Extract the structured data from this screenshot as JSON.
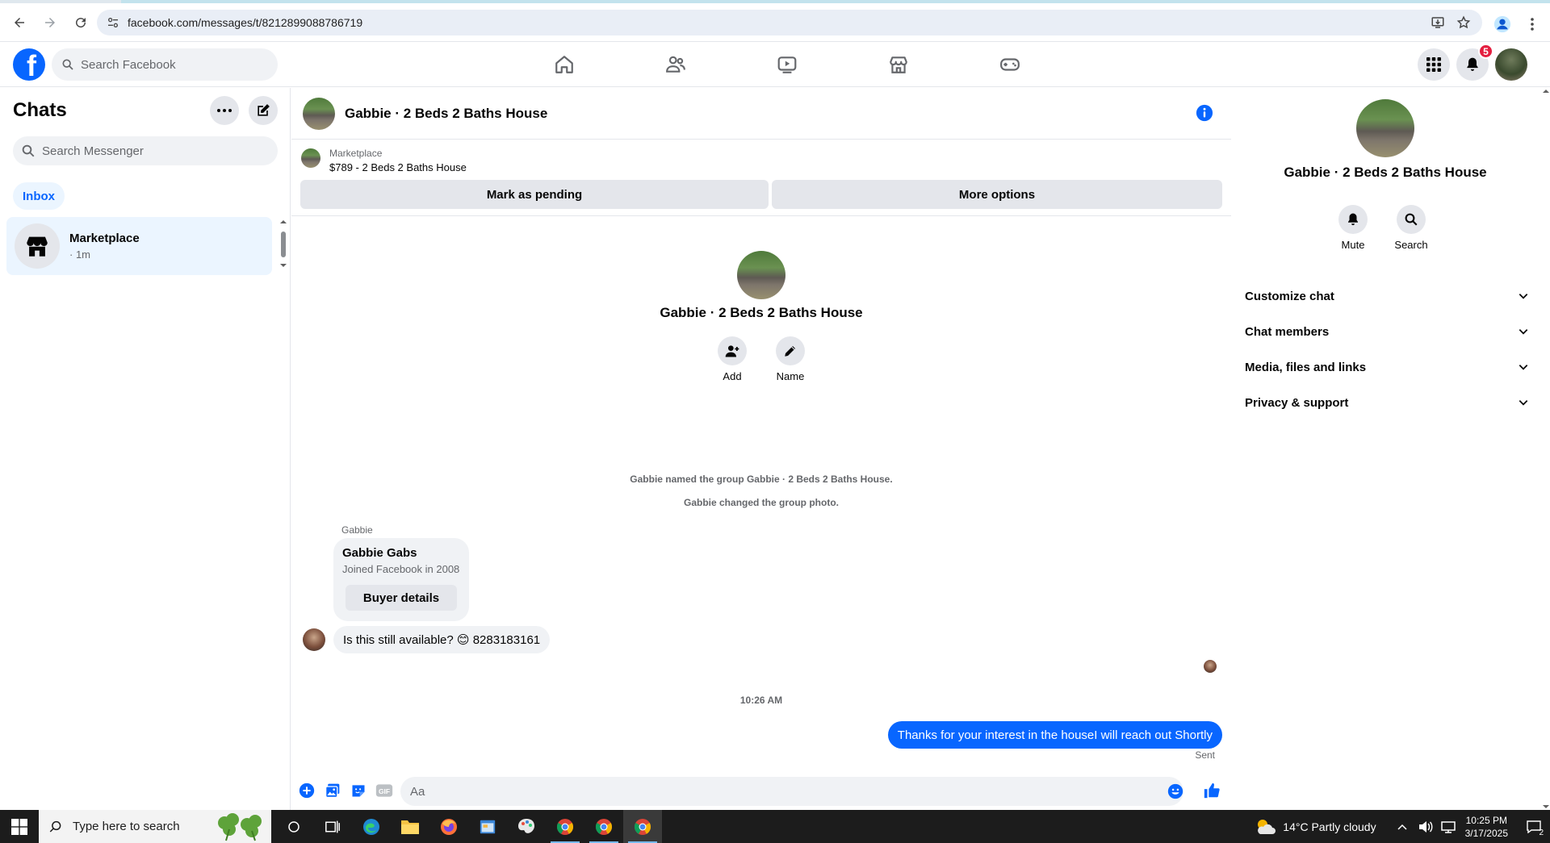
{
  "browser": {
    "url": "facebook.com/messages/t/8212899088786719"
  },
  "fb": {
    "logo_letter": "f",
    "search_placeholder": "Search Facebook",
    "notifications_count": "5"
  },
  "sidebar": {
    "title": "Chats",
    "search_placeholder": "Search Messenger",
    "inbox_label": "Inbox",
    "chats": [
      {
        "name": "Marketplace",
        "time": "· 1m"
      }
    ]
  },
  "conversation": {
    "title": "Gabbie · 2 Beds 2 Baths House",
    "marketplace_label": "Marketplace",
    "listing": "$789 - 2 Beds 2 Baths House",
    "mark_pending_label": "Mark as pending",
    "more_options_label": "More options",
    "group_name": "Gabbie · 2 Beds 2 Baths House",
    "add_label": "Add",
    "name_label": "Name",
    "system_messages": [
      "Gabbie named the group Gabbie · 2 Beds 2 Baths House.",
      "Gabbie changed the group photo."
    ],
    "sender": "Gabbie",
    "buyer_name": "Gabbie Gabs",
    "buyer_joined": "Joined Facebook in 2008",
    "buyer_details_label": "Buyer details",
    "incoming_message": "Is this still available? 😊 8283183161",
    "timestamp": "10:26 AM",
    "outgoing_message": "Thanks for your interest in the houseI will reach out Shortly",
    "sent_label": "Sent",
    "composer_placeholder": "Aa"
  },
  "right_panel": {
    "name": "Gabbie · 2 Beds 2 Baths House",
    "mute_label": "Mute",
    "search_label": "Search",
    "sections": [
      "Customize chat",
      "Chat members",
      "Media, files and links",
      "Privacy & support"
    ]
  },
  "taskbar": {
    "search_placeholder": "Type here to search",
    "weather": "14°C  Partly cloudy",
    "time": "10:25 PM",
    "date": "3/17/2025",
    "notification_count": "2"
  },
  "colors": {
    "accent": "#0866ff",
    "badge": "#e41e3f",
    "selected_bg": "#ebf5ff"
  }
}
